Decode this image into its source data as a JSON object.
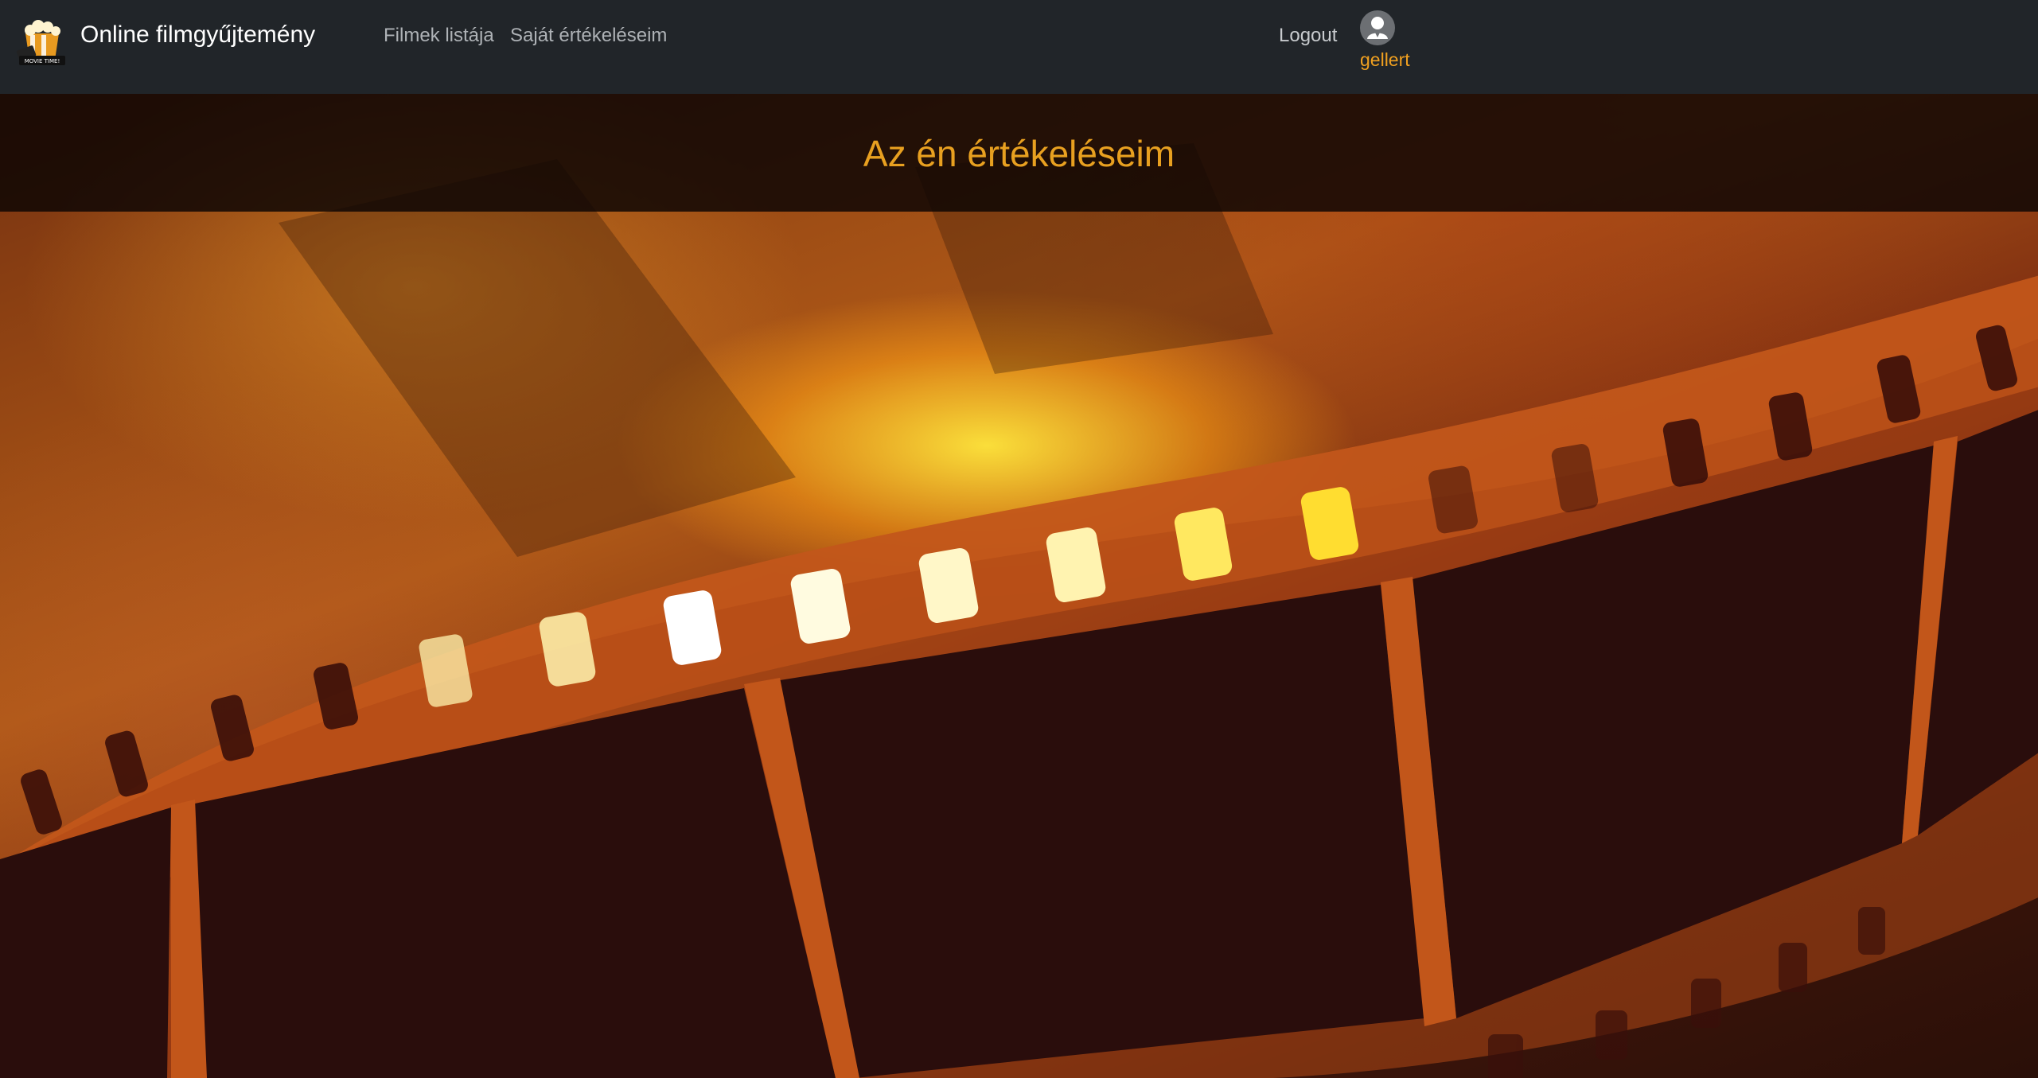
{
  "navbar": {
    "brand_name": "Online filmgyűjtemény",
    "brand_logo_icon": "popcorn-movie-logo-icon",
    "logo_text": "MOVIE TIME!",
    "links": [
      {
        "label": "Filmek listája"
      },
      {
        "label": "Saját értékeléseim"
      }
    ],
    "logout_label": "Logout",
    "user": {
      "avatar_icon": "user-avatar-icon",
      "name": "gellert"
    }
  },
  "page": {
    "title": "Az én értékeléseim"
  },
  "background": {
    "image_icon": "film-reel-background",
    "accent_color": "#e8a020"
  },
  "colors": {
    "navbar_bg": "#212529",
    "title": "#e8a020",
    "username": "#f0a020",
    "nav_link": "#aeb2b6"
  }
}
